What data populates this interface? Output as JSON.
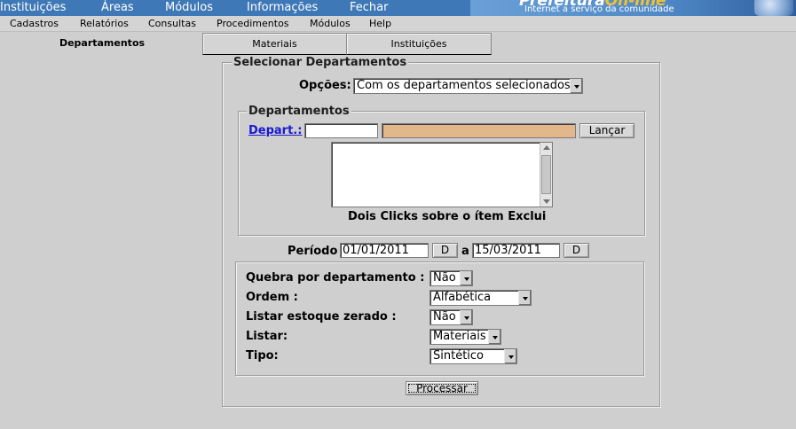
{
  "top_menu": [
    {
      "label": "Instituições"
    },
    {
      "label": "Áreas"
    },
    {
      "label": "Módulos"
    },
    {
      "label": "Informações"
    },
    {
      "label": "Fechar"
    }
  ],
  "brand": {
    "name_part1": "Prefeitura",
    "name_part2": "On-line",
    "tagline": "Internet a serviço da comunidade",
    "accent_color": "#f2c230"
  },
  "menu_bar": [
    "Cadastros",
    "Relatórios",
    "Consultas",
    "Procedimentos",
    "Módulos",
    "Help"
  ],
  "tabs": [
    {
      "label": "Departamentos",
      "active": true
    },
    {
      "label": "Materiais",
      "active": false
    },
    {
      "label": "Instituições",
      "active": false
    }
  ],
  "form": {
    "legend": "Selecionar Departamentos",
    "opcoes_label": "Opções:",
    "opcoes_value": "Com os departamentos selecionados",
    "departamentos": {
      "legend": "Departamentos",
      "depart_link": "Depart.:",
      "code_value": "",
      "name_value": "",
      "lancar_button": "Lançar",
      "hint": "Dois Clicks sobre o ítem Exclui"
    },
    "periodo": {
      "label": "Período",
      "start": "01/01/2011",
      "d_button": "D",
      "separator": "a",
      "end": "15/03/2011"
    },
    "options": {
      "quebra_label": "Quebra por departamento :",
      "quebra_value": "Não",
      "ordem_label": "Ordem :",
      "ordem_value": "Alfabética",
      "estoque_label": "Listar estoque zerado :",
      "estoque_value": "Não",
      "listar_label": "Listar:",
      "listar_value": "Materiais",
      "tipo_label": "Tipo:",
      "tipo_value": "Sintético"
    },
    "processar_button": "Processar"
  }
}
